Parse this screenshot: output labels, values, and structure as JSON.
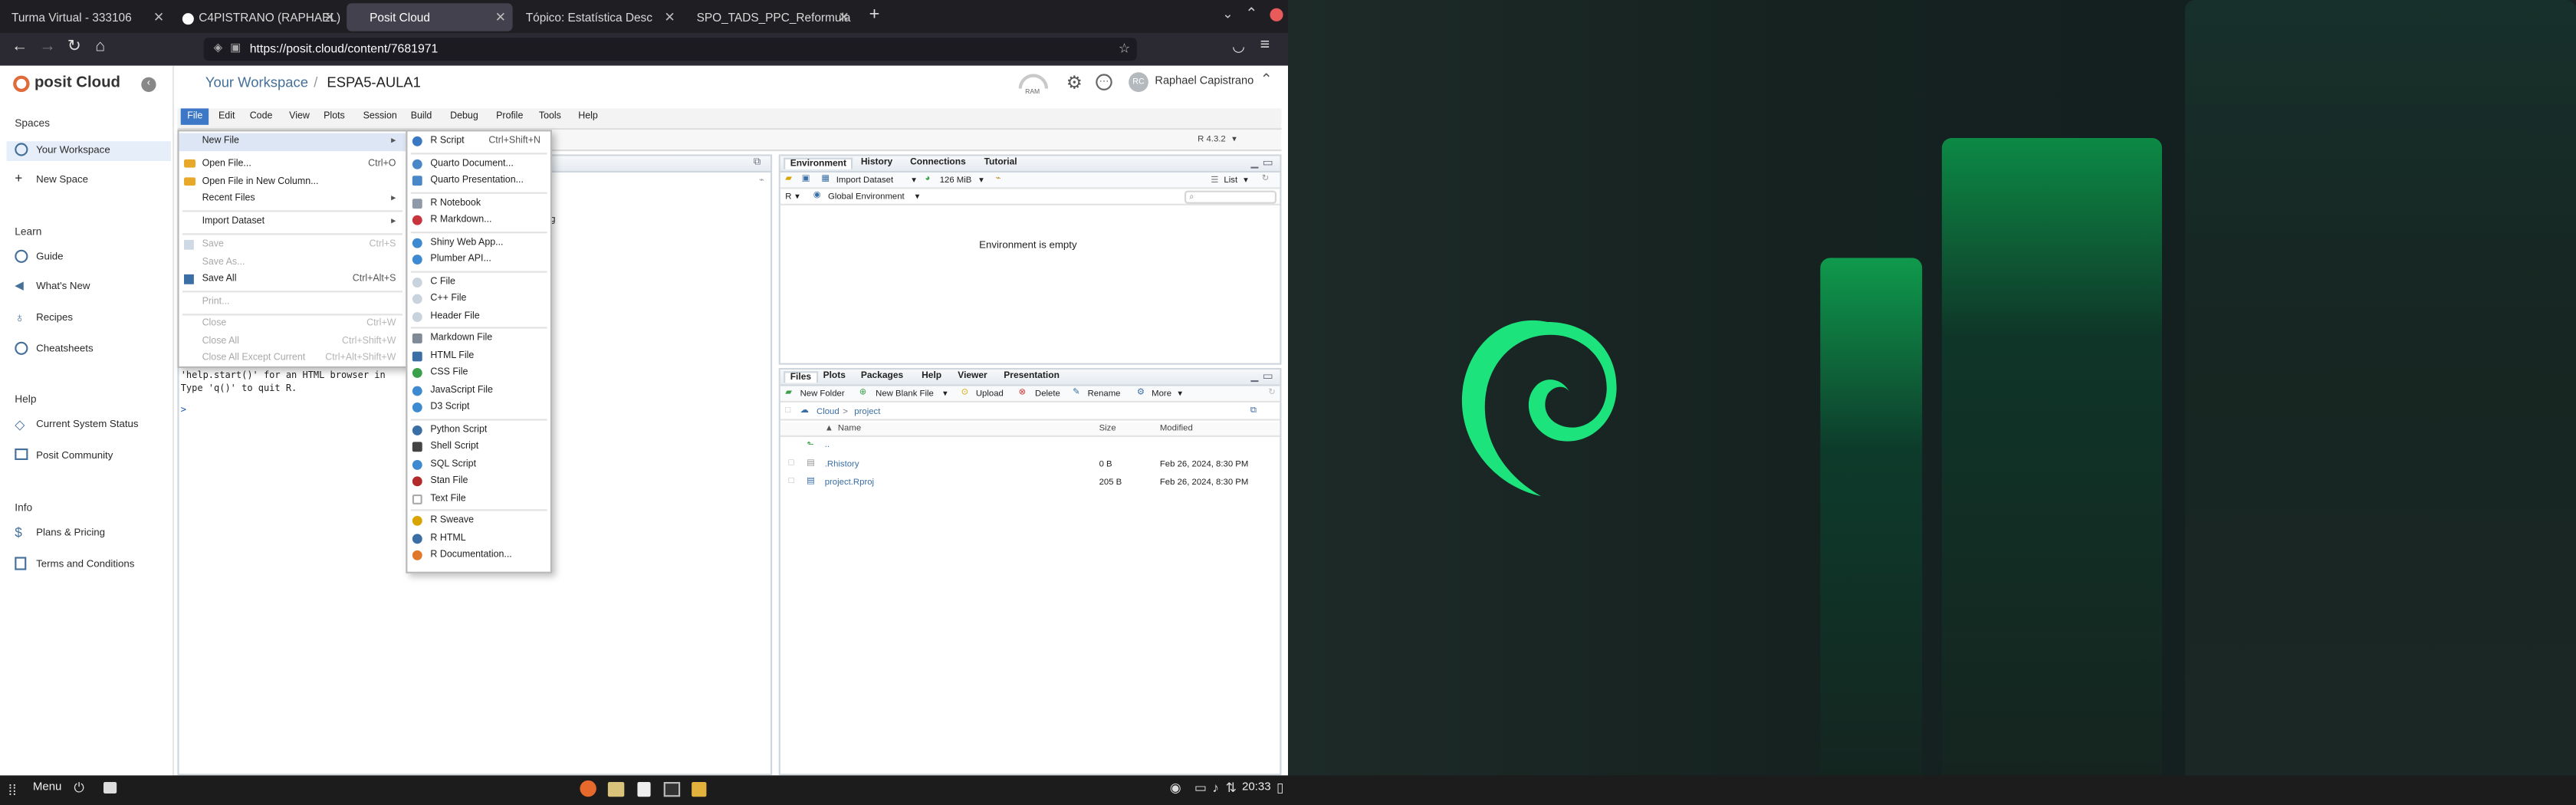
{
  "browser": {
    "tabs": [
      {
        "label": "Turma Virtual - 333106"
      },
      {
        "label": "C4PISTRANO (RAPHAEL)"
      },
      {
        "label": "Posit Cloud"
      },
      {
        "label": "Tópico: Estatística Desc"
      },
      {
        "label": "SPO_TADS_PPC_Reformula"
      }
    ],
    "url": "https://posit.cloud/content/7681971"
  },
  "posit": {
    "brand": "posit Cloud",
    "breadcrumb_workspace": "Your Workspace",
    "breadcrumb_sep": "/",
    "project_name": "ESPA5-AULA1",
    "ram_label": "RAM",
    "user_initials": "RC",
    "user_name": "Raphael Capistrano",
    "sidebar": {
      "spaces_heading": "Spaces",
      "your_workspace": "Your Workspace",
      "new_space": "New Space",
      "learn_heading": "Learn",
      "guide": "Guide",
      "whats_new": "What's New",
      "recipes": "Recipes",
      "cheatsheets": "Cheatsheets",
      "help_heading": "Help",
      "system_status": "Current System Status",
      "community": "Posit Community",
      "info_heading": "Info",
      "plans": "Plans & Pricing",
      "terms": "Terms and Conditions"
    }
  },
  "rstudio": {
    "menubar": [
      "File",
      "Edit",
      "Code",
      "View",
      "Plots",
      "Session",
      "Build",
      "Debug",
      "Profile",
      "Tools",
      "Help"
    ],
    "r_version": "R 4.3.2",
    "console_lines": [
      "'help.start()' for an HTML browser in",
      "Type 'q()' to quit R.",
      ">"
    ],
    "console_fragment": "g",
    "env_tabs": [
      "Environment",
      "History",
      "Connections",
      "Tutorial"
    ],
    "import_dataset": "Import Dataset",
    "memory": "126 MiB",
    "list_label": "List",
    "r_dropdown": "R",
    "global_env": "Global Environment",
    "env_empty": "Environment is empty",
    "files_tabs": [
      "Files",
      "Plots",
      "Packages",
      "Help",
      "Viewer",
      "Presentation"
    ],
    "files_toolbar": {
      "new_folder": "New Folder",
      "new_blank": "New Blank File",
      "upload": "Upload",
      "delete": "Delete",
      "rename": "Rename",
      "more": "More"
    },
    "path_cloud": "Cloud",
    "path_project": "project",
    "path_sep": ">",
    "columns": {
      "name": "Name",
      "size": "Size",
      "modified": "Modified"
    },
    "parent_dir": "..",
    "files": [
      {
        "name": ".Rhistory",
        "size": "0 B",
        "modified": "Feb 26, 2024, 8:30 PM"
      },
      {
        "name": "project.Rproj",
        "size": "205 B",
        "modified": "Feb 26, 2024, 8:30 PM"
      }
    ]
  },
  "file_menu": {
    "items": [
      {
        "label": "New File",
        "shortcut": ""
      },
      {
        "label": "Open File...",
        "shortcut": "Ctrl+O"
      },
      {
        "label": "Open File in New Column...",
        "shortcut": ""
      },
      {
        "label": "Recent Files",
        "shortcut": ""
      },
      {
        "label": "Import Dataset",
        "shortcut": ""
      },
      {
        "label": "Save",
        "shortcut": "Ctrl+S"
      },
      {
        "label": "Save As...",
        "shortcut": ""
      },
      {
        "label": "Save All",
        "shortcut": "Ctrl+Alt+S"
      },
      {
        "label": "Print...",
        "shortcut": ""
      },
      {
        "label": "Close",
        "shortcut": "Ctrl+W"
      },
      {
        "label": "Close All",
        "shortcut": "Ctrl+Shift+W"
      },
      {
        "label": "Close All Except Current",
        "shortcut": "Ctrl+Alt+Shift+W"
      }
    ]
  },
  "new_file_menu": {
    "items": [
      {
        "label": "R Script",
        "shortcut": "Ctrl+Shift+N"
      },
      {
        "label": "Quarto Document..."
      },
      {
        "label": "Quarto Presentation..."
      },
      {
        "label": "R Notebook"
      },
      {
        "label": "R Markdown..."
      },
      {
        "label": "Shiny Web App..."
      },
      {
        "label": "Plumber API..."
      },
      {
        "label": "C File"
      },
      {
        "label": "C++ File"
      },
      {
        "label": "Header File"
      },
      {
        "label": "Markdown File"
      },
      {
        "label": "HTML File"
      },
      {
        "label": "CSS File"
      },
      {
        "label": "JavaScript File"
      },
      {
        "label": "D3 Script"
      },
      {
        "label": "Python Script"
      },
      {
        "label": "Shell Script"
      },
      {
        "label": "SQL Script"
      },
      {
        "label": "Stan File"
      },
      {
        "label": "Text File"
      },
      {
        "label": "R Sweave"
      },
      {
        "label": "R HTML"
      },
      {
        "label": "R Documentation..."
      }
    ]
  },
  "taskbar": {
    "menu_label": "Menu",
    "clock": "20:33"
  },
  "colors": {
    "posit_blue": "#447099",
    "accent_green": "#00c853",
    "firefox_dark": "#1f1f23"
  }
}
